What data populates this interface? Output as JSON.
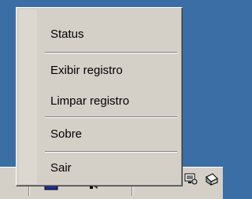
{
  "desktop": {
    "background_color": "#3a6ea5"
  },
  "taskbar": {
    "background_color": "#d4d0c8",
    "tray_icons": [
      {
        "name": "network-icon"
      },
      {
        "name": "speaker-icon"
      },
      {
        "name": "monitor-icon"
      },
      {
        "name": "printer-icon"
      }
    ]
  },
  "context_menu": {
    "items": [
      {
        "label": "Status"
      },
      {
        "label": "Exibir registro"
      },
      {
        "label": "Limpar registro"
      },
      {
        "label": "Sobre"
      },
      {
        "label": "Sair"
      }
    ]
  }
}
